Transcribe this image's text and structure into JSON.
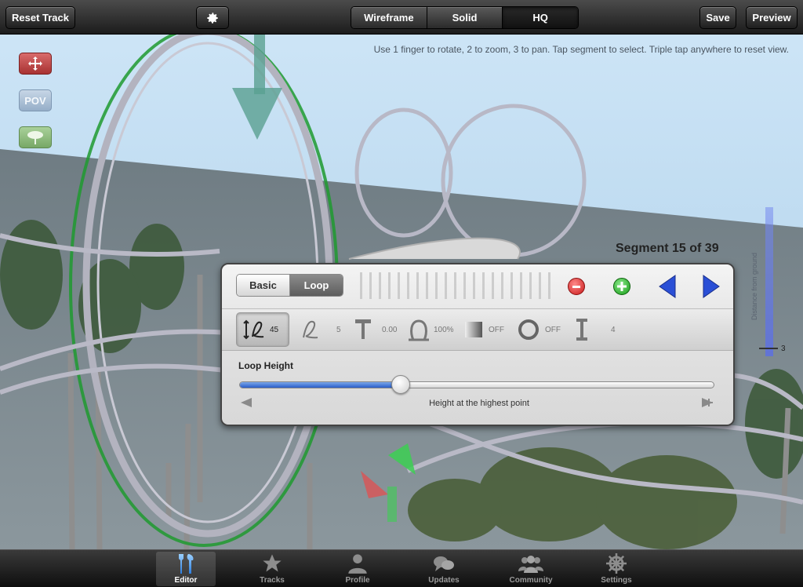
{
  "toolbar": {
    "reset_label": "Reset Track",
    "save_label": "Save",
    "preview_label": "Preview",
    "render_modes": [
      "Wireframe",
      "Solid",
      "HQ"
    ],
    "selected_mode": "HQ"
  },
  "hint_text": "Use 1 finger to rotate, 2 to zoom, 3 to pan. Tap segment to select. Triple tap anywhere to reset view.",
  "side_tools": {
    "pov_label": "POV"
  },
  "segment_title": "Segment 15 of 39",
  "gauge": {
    "label": "Distance from ground",
    "value": "3"
  },
  "panel": {
    "tabs": [
      "Basic",
      "Loop"
    ],
    "selected_tab": "Loop",
    "params": [
      {
        "icon": "loop-height-icon",
        "value": "45"
      },
      {
        "icon": "loop-shape-icon",
        "value": "5"
      },
      {
        "icon": "pin-icon",
        "value": "0.00"
      },
      {
        "icon": "loop-ratio-icon",
        "value": "100%"
      },
      {
        "icon": "gradient-icon",
        "value": "OFF"
      },
      {
        "icon": "ring-icon",
        "value": "OFF"
      },
      {
        "icon": "support-icon",
        "value": "4"
      }
    ],
    "slider_label": "Loop Height",
    "slider_caption": "Height at the highest point",
    "slider_fraction": 0.34
  },
  "tabs": [
    {
      "label": "Editor",
      "icon": "editor-tools-icon"
    },
    {
      "label": "Tracks",
      "icon": "star-icon"
    },
    {
      "label": "Profile",
      "icon": "person-icon"
    },
    {
      "label": "Updates",
      "icon": "speech-bubbles-icon"
    },
    {
      "label": "Community",
      "icon": "people-icon"
    },
    {
      "label": "Settings",
      "icon": "ship-wheel-icon"
    }
  ],
  "colors": {
    "accent_blue": "#2a5dc9",
    "remove_red": "#c81818",
    "add_green": "#149a14",
    "selection_green": "#1f9a2f"
  }
}
